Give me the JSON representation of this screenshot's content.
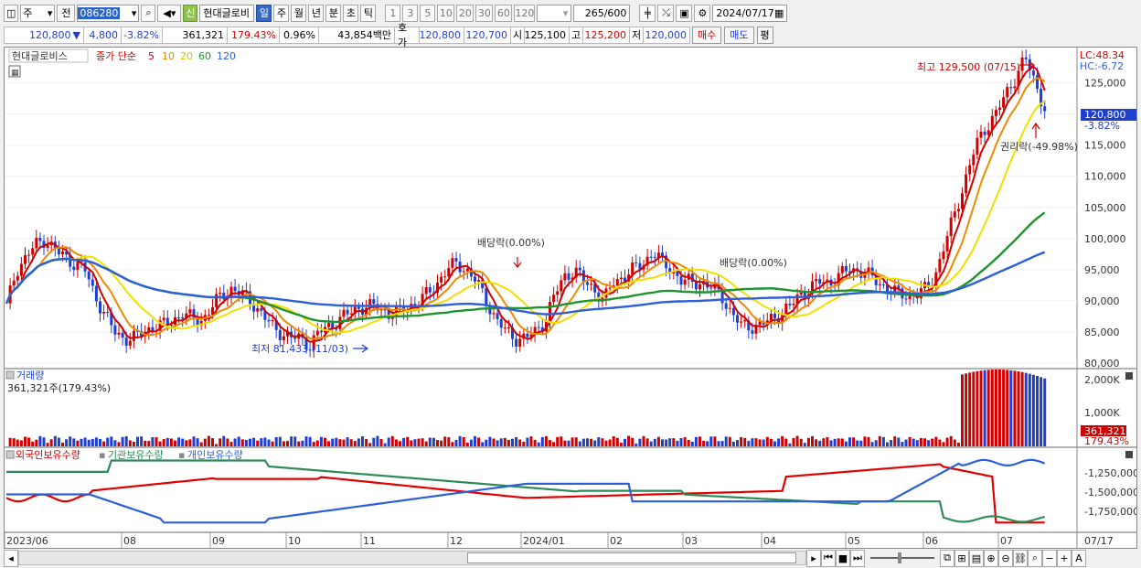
{
  "toolbar": {
    "type_label": "주",
    "prev_label": "전",
    "code_value": "086280",
    "stock_tag": "신",
    "stock_name": "현대글로비",
    "periods": [
      "일",
      "주",
      "월",
      "년",
      "분",
      "초",
      "틱"
    ],
    "active_period": "일",
    "intervals": [
      "1",
      "3",
      "5",
      "10",
      "20",
      "30",
      "60",
      "120"
    ],
    "count_value": "265",
    "count_total": "/600",
    "date_value": "2024/07/17"
  },
  "quote": {
    "price": "120,800",
    "arrow": "▼",
    "change": "4,800",
    "change_pct": "-3.82%",
    "volume": "361,321",
    "volume_pct": "179.43%",
    "turnover_pct": "0.96%",
    "amount": "43,854백만",
    "ask_label": "호가",
    "ask": "120,800",
    "bid": "120,700",
    "open_label": "시",
    "open": "125,100",
    "high_label": "고",
    "high": "125,200",
    "low_label": "저",
    "low": "120,000",
    "buy_label": "매수",
    "sell_label": "매도",
    "eval_label": "평"
  },
  "chart": {
    "name": "현대글로비스",
    "ma_title": "종가 단순",
    "ma_periods": [
      "5",
      "10",
      "20",
      "60",
      "120"
    ],
    "ma_colors": [
      "#d40000",
      "#f08a00",
      "#f0e000",
      "#1e9430",
      "#2c5fd8"
    ],
    "lc": "LC:48.34",
    "hc": "HC:-6.72",
    "high_note": "최고 129,500 (07/15)",
    "low_note": "최저 81,433 (11/03)",
    "dividend_note_1": "배당락(0.00%)",
    "dividend_note_2": "배당락(0.00%)",
    "rights_note": "권리락(-49.98%)",
    "price_ticks": [
      "125,000",
      "120,000",
      "115,000",
      "110,000",
      "105,000",
      "100,000",
      "95,000",
      "90,000",
      "85,000",
      "80,000"
    ],
    "current_price_tag": "120,800",
    "current_pct_tag": "-3.82%"
  },
  "volume": {
    "title": "거래량",
    "value": "361,321주(179.43%)",
    "ticks": [
      "2,000K",
      "1,000K"
    ],
    "tag_value": "361,321",
    "tag_pct": "179.43%"
  },
  "holdings": {
    "title_foreign": "외국인보유수량",
    "title_inst": "기관보유수량",
    "title_indiv": "개인보유수량",
    "ticks": [
      "-1,250,000",
      "-1,500,000",
      "-1,750,000"
    ]
  },
  "xaxis": {
    "labels": [
      "2023/06",
      "08",
      "09",
      "10",
      "11",
      "12",
      "2024/01",
      "02",
      "03",
      "04",
      "05",
      "06",
      "07"
    ],
    "end_label": "07/17"
  },
  "chart_data": {
    "type": "line",
    "price_series_approx": [
      89,
      95,
      97,
      99,
      100,
      98,
      97,
      96,
      95,
      91,
      88,
      85,
      84,
      84,
      85,
      86,
      86,
      87,
      88,
      87,
      87,
      89,
      91,
      92,
      91,
      90,
      88,
      86,
      85,
      84,
      84,
      83,
      85,
      86,
      87,
      88,
      89,
      89,
      89,
      88,
      88,
      89,
      90,
      91,
      93,
      95,
      96,
      95,
      93,
      90,
      87,
      85,
      84,
      84,
      85,
      87,
      91,
      94,
      95,
      93,
      92,
      90,
      93,
      94,
      95,
      96,
      98,
      96,
      95,
      93,
      93,
      93,
      92,
      91,
      88,
      86,
      86,
      86,
      87,
      88,
      89,
      91,
      92,
      93,
      93,
      94,
      95,
      95,
      94,
      93,
      92,
      91,
      91,
      91,
      92,
      95,
      100,
      105,
      110,
      115,
      118,
      120,
      123,
      126,
      129,
      125,
      121
    ],
    "ylim": [
      80000,
      127000
    ]
  },
  "colors": {
    "up": "#d00000",
    "down": "#1f3fd0",
    "foreign": "#e00000",
    "institution": "#2e8b57",
    "individual": "#2c5fd8"
  }
}
